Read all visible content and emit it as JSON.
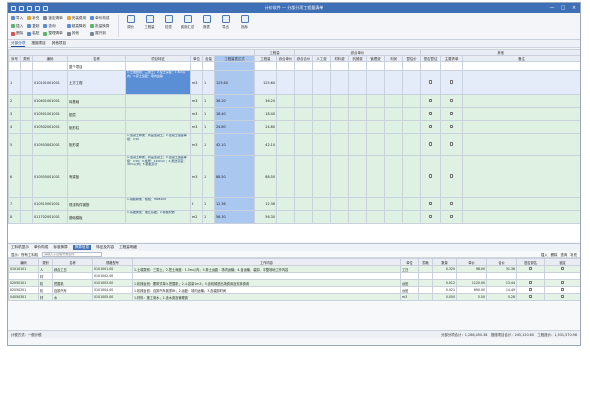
{
  "window": {
    "title": "计价软件 — 分部分项工程量清单",
    "controls": [
      "—",
      "□",
      "×"
    ]
  },
  "toolbar": {
    "small_tools": [
      [
        "导入",
        "插入",
        "删除"
      ],
      [
        "补充",
        "复制",
        "粘贴"
      ],
      [
        "锁定清单",
        "查询",
        "整理清单"
      ],
      [
        "安装费用",
        "超高降效",
        "其他"
      ],
      [
        "单价构成",
        "批量换算",
        "展开到"
      ]
    ],
    "big_tools": [
      "调价",
      "工程量",
      "检查",
      "费用汇总",
      "报表",
      "导出",
      "指标"
    ]
  },
  "subtabs": [
    "分部分项",
    "措施项目",
    "其他项目"
  ],
  "grid": {
    "group_headers": {
      "quota": "工程量",
      "price": "综合单价",
      "extra": "其他"
    },
    "columns": [
      "序号",
      "类别",
      "编码",
      "名称",
      "项目特征",
      "单位",
      "含量",
      "工程量表达式",
      "工程量",
      "综合单价",
      "综合合价",
      "人工费",
      "材料费",
      "机械费",
      "管理费",
      "利润",
      "暂估价",
      "是否暂估",
      "主要清单",
      "备注"
    ],
    "rows": [
      {
        "no": "",
        "type": "",
        "code": "",
        "name": "整个项目",
        "desc": "",
        "unit": "",
        "qty": "",
        "expr": "",
        "amount": "",
        "kind": "w"
      },
      {
        "no": "1",
        "type": "",
        "code": "010101001001",
        "name": "土方工程",
        "desc": "1.土壤类别：三类土；2.挖土深度：1.5m以内；3.弃土运距：场内运输",
        "unit": "m3",
        "qty": "1",
        "expr": "125.60",
        "amount": "125.60",
        "kind": "sel"
      },
      {
        "no": "2",
        "type": "",
        "code": "010401001001",
        "name": "砖基础",
        "desc": "",
        "unit": "m3",
        "qty": "1",
        "expr": "36.20",
        "amount": "36.20",
        "kind": "g"
      },
      {
        "no": "3",
        "type": "",
        "code": "010501001001",
        "name": "垫层",
        "desc": "",
        "unit": "m3",
        "qty": "1",
        "expr": "18.40",
        "amount": "18.40",
        "kind": "g"
      },
      {
        "no": "4",
        "type": "",
        "code": "010502001001",
        "name": "矩形柱",
        "desc": "",
        "unit": "m3",
        "qty": "1",
        "expr": "24.80",
        "amount": "24.80",
        "kind": "g"
      },
      {
        "no": "5",
        "type": "",
        "code": "010503002001",
        "name": "矩形梁",
        "desc": "1.混凝土种类：商品混凝土；2.混凝土强度等级：C30",
        "unit": "m3",
        "qty": "1",
        "expr": "42.10",
        "amount": "42.10",
        "kind": "g"
      },
      {
        "no": "6",
        "type": "",
        "code": "010505001001",
        "name": "有梁板",
        "desc": "1.混凝土种类：商品混凝土；2.混凝土强度等级：C30；3.板厚：120mm；4.泵送高度：30m以内；5.模板另计",
        "unit": "m3",
        "qty": "1",
        "expr": "88.50",
        "amount": "88.50",
        "kind": "g"
      },
      {
        "no": "7",
        "type": "",
        "code": "010515001001",
        "name": "现浇构件钢筋",
        "desc": "1.钢筋种类、规格：HRB400",
        "unit": "t",
        "qty": "1",
        "expr": "12.36",
        "amount": "12.36",
        "kind": "g"
      },
      {
        "no": "8",
        "type": "",
        "code": "011702001001",
        "name": "基础模板",
        "desc": "1.基础类型：独立基础；2.模板材质",
        "unit": "m2",
        "qty": "1",
        "expr": "56.30",
        "amount": "56.30",
        "kind": "g"
      }
    ]
  },
  "bottom": {
    "tabs": [
      "工料机显示",
      "单价构成",
      "标准换算",
      "换算信息",
      "特征及内容",
      "工程量明细"
    ],
    "active_tab": 3,
    "filter_label": "显示：所有工料机",
    "search_placeholder": "请输入子目编号或名称",
    "right_tools": [
      "插入",
      "删除",
      "查询",
      "补充"
    ],
    "columns": [
      "编码",
      "类别",
      "名称",
      "规格型号",
      "工作内容",
      "单位",
      "损耗",
      "数量",
      "单价",
      "合价",
      "是否暂估",
      "锁定"
    ],
    "rows": [
      {
        "code": "01010101",
        "type": "人",
        "name": "综合工日",
        "spec": "0101001.00",
        "content": "1.土壤类别：三类土；2.挖土深度：1.5m以内；3.弃土运距：场内运输；4.含运输、装卸、平整场地工作内容",
        "unit": "工日",
        "loss": "",
        "qty": "0.320",
        "price": "98.00",
        "total": "31.36"
      },
      {
        "code": "",
        "type": "材",
        "name": "",
        "spec": "0101002.00",
        "content": "",
        "unit": "",
        "loss": "",
        "qty": "",
        "price": "",
        "total": ""
      },
      {
        "code": "02050101",
        "type": "机",
        "name": "挖掘机",
        "spec": "0101003.00",
        "content": "1.机械台班：履带式单斗挖掘机；2.斗容量1m3；3.含机械进出场费用及安拆费用",
        "unit": "台班",
        "loss": "",
        "qty": "0.012",
        "price": "1120.00",
        "total": "13.44"
      },
      {
        "code": "02050201",
        "type": "机",
        "name": "自卸汽车",
        "spec": "0101004.00",
        "content": "1.机械台班：自卸汽车载重8t；2.运距：场内运输；3.含装卸时间",
        "unit": "台班",
        "loss": "",
        "qty": "0.021",
        "price": "690.00",
        "total": "14.49"
      },
      {
        "code": "04050301",
        "type": "材",
        "name": "水",
        "spec": "0101005.00",
        "content": "1.材料：施工用水；2.含水费及管理费",
        "unit": "m3",
        "loss": "",
        "qty": "0.050",
        "price": "5.50",
        "total": "0.28"
      }
    ]
  },
  "status": {
    "left": "计税方式：一般计税",
    "right": "分部分项合计：1,286,450.38　措施项目合计：245,120.60　工程造价：1,531,570.98"
  }
}
